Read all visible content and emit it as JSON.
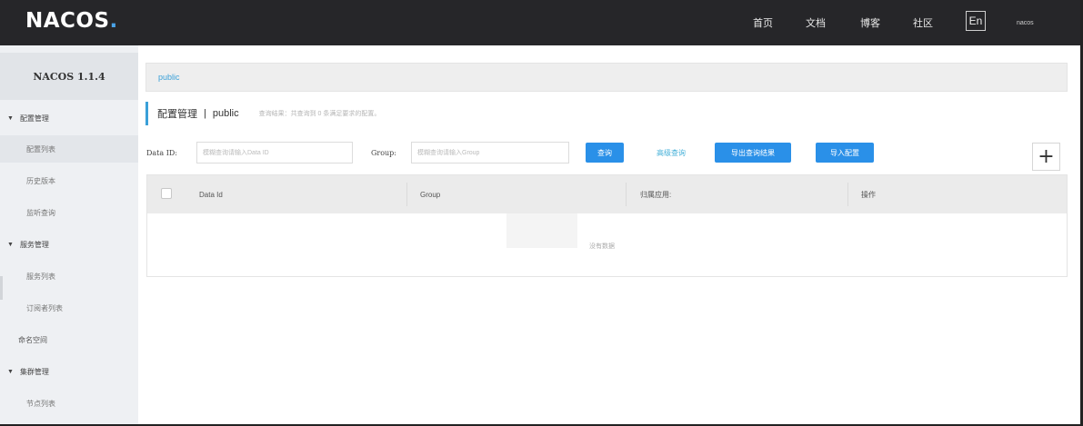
{
  "header": {
    "logo_text": "NACOS",
    "logo_dot": ".",
    "nav": [
      "首页",
      "文档",
      "博客",
      "社区"
    ],
    "lang_label": "En",
    "user": "nacos"
  },
  "sidebar": {
    "version": "NACOS 1.1.4",
    "items": [
      {
        "label": "配置管理",
        "kind": "group"
      },
      {
        "label": "配置列表",
        "kind": "sub"
      },
      {
        "label": "历史版本",
        "kind": "sub"
      },
      {
        "label": "监听查询",
        "kind": "sub"
      },
      {
        "label": "服务管理",
        "kind": "group"
      },
      {
        "label": "服务列表",
        "kind": "sub"
      },
      {
        "label": "订阅者列表",
        "kind": "sub"
      },
      {
        "label": "命名空间",
        "kind": "plain"
      },
      {
        "label": "集群管理",
        "kind": "group"
      },
      {
        "label": "节点列表",
        "kind": "sub"
      }
    ]
  },
  "breadcrumb": {
    "namespace": "public"
  },
  "page": {
    "title": "配置管理",
    "separator": "|",
    "namespace": "public",
    "hint": "查询结果：共查询到 0 条满足要求的配置。"
  },
  "search": {
    "dataid_label": "Data ID:",
    "dataid_placeholder": "模糊查询请输入Data ID",
    "group_label": "Group:",
    "group_placeholder": "模糊查询请输入Group",
    "query_button": "查询",
    "advanced_link": "高级查询",
    "export_button": "导出查询结果",
    "import_button": "导入配置",
    "add_button": "+"
  },
  "table": {
    "columns": [
      "Data Id",
      "Group",
      "归属应用:",
      "操作"
    ],
    "empty_text": "没有数据"
  },
  "colors": {
    "header_bg": "#262629",
    "accent": "#2a90e8",
    "link": "#45b0d8",
    "sidebar_bg": "#eef0f3"
  }
}
